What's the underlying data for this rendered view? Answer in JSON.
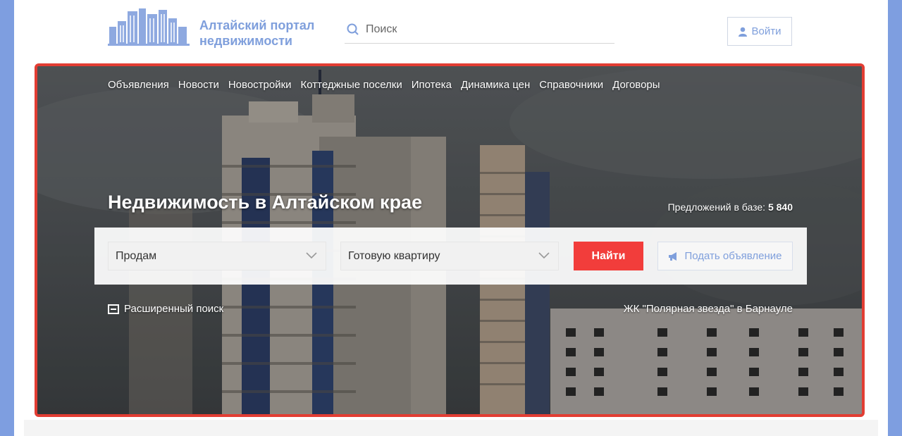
{
  "header": {
    "logo_line1": "Алтайский портал",
    "logo_line2": "недвижимости",
    "search_placeholder": "Поиск",
    "login_label": "Войти"
  },
  "nav": {
    "items": [
      "Объявления",
      "Новости",
      "Новостройки",
      "Коттеджные поселки",
      "Ипотека",
      "Динамика цен",
      "Справочники",
      "Договоры"
    ]
  },
  "hero": {
    "title": "Недвижимость в Алтайском крае",
    "offers_label": "Предложений в базе:",
    "offers_count": "5 840",
    "deal_select": "Продам",
    "type_select": "Готовую квартиру",
    "find_button": "Найти",
    "add_button": "Подать объявление",
    "advanced_search": "Расширенный поиск",
    "complex_caption": "ЖК \"Полярная звезда\" в Барнауле"
  },
  "colors": {
    "accent": "#7f9fdc",
    "hero_border": "#e23d33",
    "find_button": "#f23d3b",
    "page_background": "#7e9ee0"
  },
  "icons": {
    "search": "search-icon",
    "login": "user-icon",
    "select_arrow": "chevron-down-icon",
    "add": "megaphone-icon",
    "advanced": "minus-square-icon"
  }
}
